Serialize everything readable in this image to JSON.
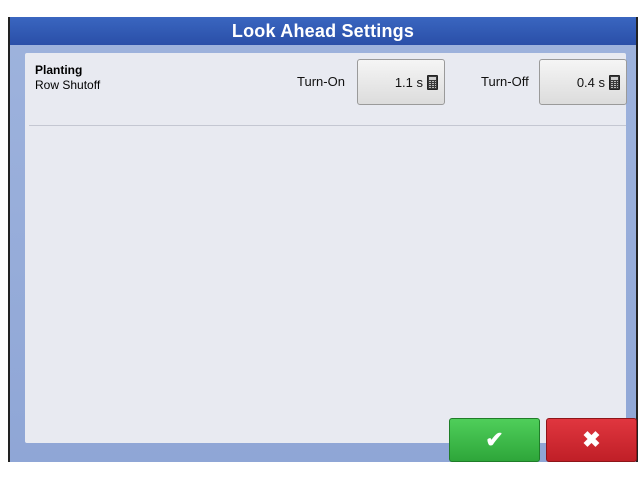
{
  "window": {
    "title": "Look Ahead Settings"
  },
  "row": {
    "title": "Planting",
    "subtitle": "Row Shutoff",
    "turn_on_label": "Turn-On",
    "turn_on_value": "1.1 s",
    "turn_off_label": "Turn-Off",
    "turn_off_value": "0.4 s"
  },
  "buttons": {
    "ok_glyph": "✔",
    "cancel_glyph": "✖"
  },
  "colors": {
    "title_bar": "#2f57b0",
    "frame": "#93a9d8",
    "ok": "#34b040",
    "cancel": "#cf252d"
  },
  "icons": {
    "calculator": "calculator-icon",
    "ok": "checkmark-icon",
    "cancel": "close-icon"
  }
}
